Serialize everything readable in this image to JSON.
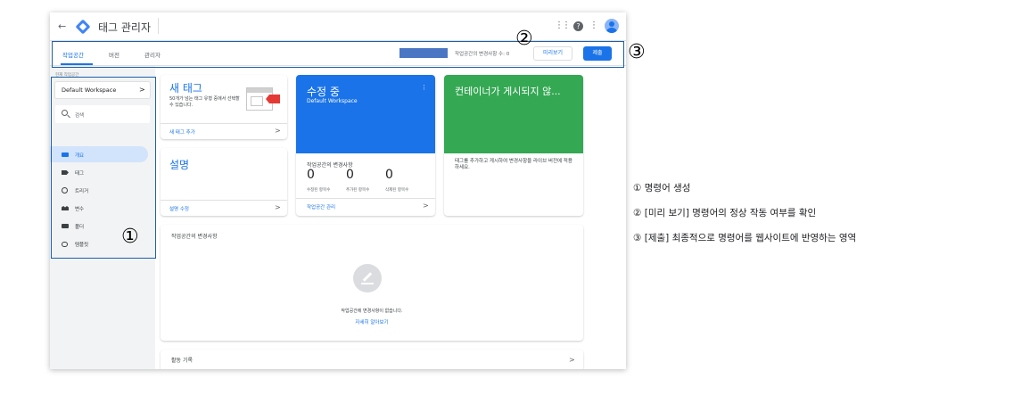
{
  "topbar": {
    "back_icon": "←",
    "title": "태그 관리자",
    "apps_icon": "⋮⋮",
    "help_icon": "?",
    "more_icon": "⋮"
  },
  "tabs": [
    {
      "label": "작업공간",
      "active": true
    },
    {
      "label": "버전",
      "active": false
    },
    {
      "label": "관리자",
      "active": false
    }
  ],
  "toolbar": {
    "changes_count": "작업공간의 변경사항 수: 0",
    "preview_label": "미리보기",
    "submit_label": "제출"
  },
  "sidebar": {
    "workspace_label": "현재 작업공간",
    "workspace_name": "Default Workspace",
    "workspace_chevron": ">",
    "search_placeholder": "검색",
    "items": [
      {
        "label": "개요",
        "active": true,
        "icon": "folder-icon"
      },
      {
        "label": "태그",
        "active": false,
        "icon": "tag-icon"
      },
      {
        "label": "트리거",
        "active": false,
        "icon": "trigger-icon"
      },
      {
        "label": "변수",
        "active": false,
        "icon": "variable-icon"
      },
      {
        "label": "폴더",
        "active": false,
        "icon": "folder-icon"
      },
      {
        "label": "템플릿",
        "active": false,
        "icon": "template-icon"
      }
    ]
  },
  "cards": {
    "new_tag": {
      "title": "새 태그",
      "desc": "50개가 넘는 태그 유형 중에서 선택할 수 있습니다.",
      "link": "새 태그 추가",
      "chevron": ">"
    },
    "description": {
      "title": "설명",
      "link": "설명 수정",
      "chevron": ">"
    },
    "editing": {
      "title": "수정 중",
      "workspace": "Default Workspace",
      "kebab": "⋮",
      "changes_title": "작업공간의 변경사항",
      "counts": [
        {
          "value": "0",
          "label": "수정된 항목수"
        },
        {
          "value": "0",
          "label": "추가된 항목수"
        },
        {
          "value": "0",
          "label": "삭제된 항목수"
        }
      ],
      "link": "작업공간 관리",
      "chevron": ">"
    },
    "not_published": {
      "title": "컨테이너가 게시되지 않...",
      "desc": "태그를 추가하고 게시하여 변경사항을 라이브 버전에 적용하세요."
    },
    "workspace_changes": {
      "title": "작업공간의 변경사항",
      "empty_text": "작업공간에 변경사항이 없습니다.",
      "learn_more": "자세히 알아보기"
    },
    "activity": {
      "title": "활동 기록",
      "chevron": ">"
    }
  },
  "markers": {
    "one": "①",
    "two": "②",
    "three": "③"
  },
  "annotations": [
    "① 명령어 생성",
    "② [미리 보기] 명령어의 정상 작동 여부를 확인",
    "③ [제출] 최종적으로 명령어를 웹사이트에 반영하는 영역"
  ],
  "colors": {
    "accent_blue": "#1a73e8",
    "editing_card": "#1a73e8",
    "not_published_card": "#34a853",
    "highlight_border": "#1f5fa8",
    "tag_red": "#e53935"
  }
}
